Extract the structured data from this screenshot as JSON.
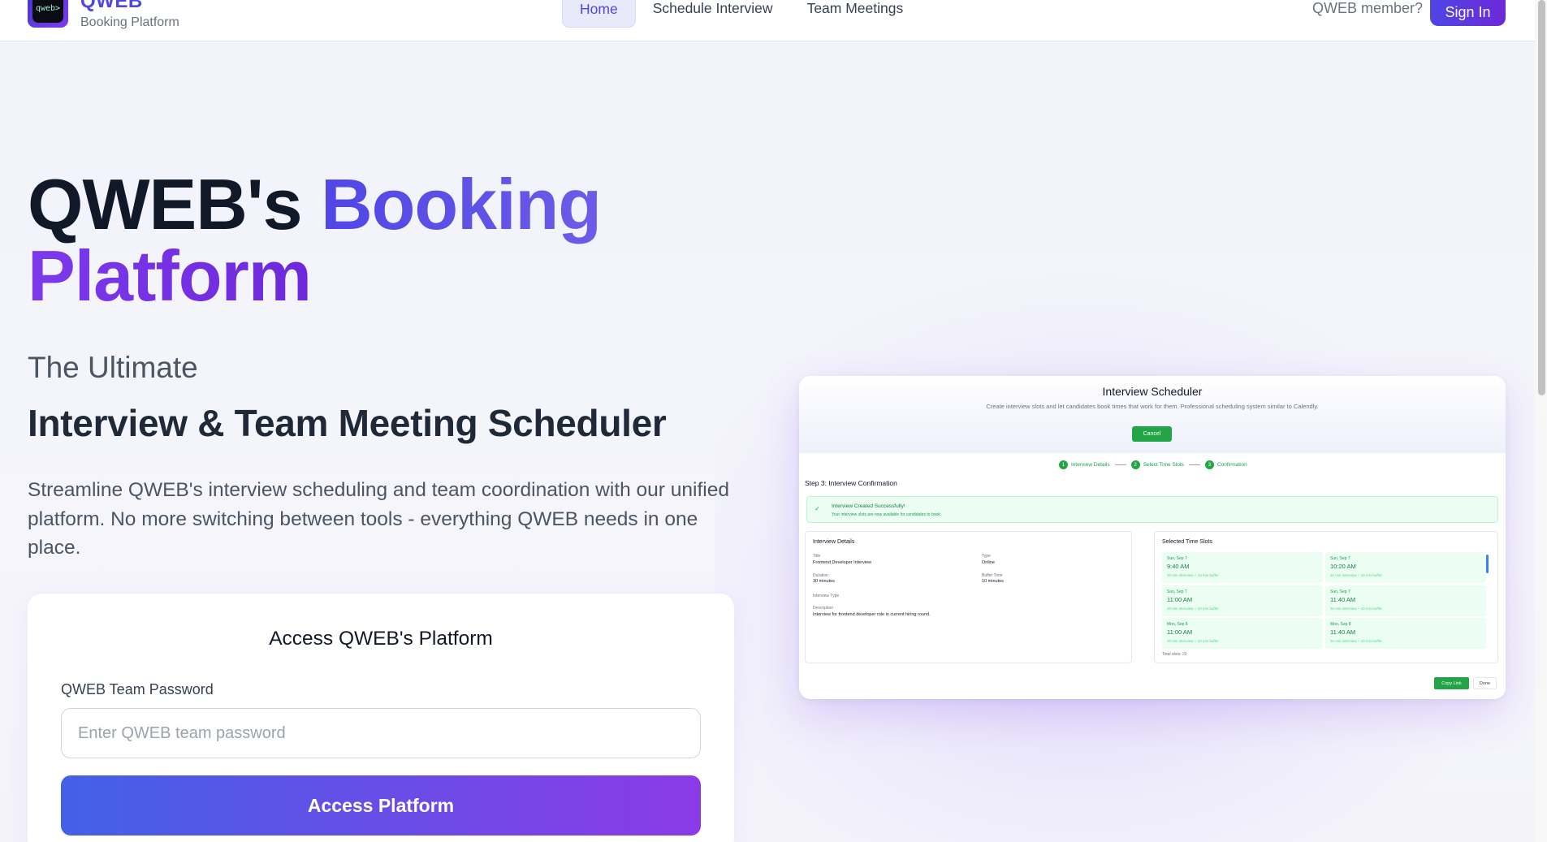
{
  "header": {
    "brand_name": "QWEB",
    "brand_subtitle": "Booking Platform",
    "logo_text": "qweb>",
    "nav": [
      {
        "label": "Home",
        "active": true
      },
      {
        "label": "Schedule Interview",
        "active": false
      },
      {
        "label": "Team Meetings",
        "active": false
      }
    ],
    "member_text": "QWEB member?",
    "signin_label": "Sign In"
  },
  "hero": {
    "title_part1": "QWEB's",
    "title_part2": "Booking",
    "title_part3": "Platform",
    "subtitle_light": "The Ultimate",
    "subtitle_bold": "Interview & Team Meeting Scheduler",
    "description": "Streamline QWEB's interview scheduling and team coordination with our unified platform. No more switching between tools - everything QWEB needs in one place."
  },
  "access": {
    "title": "Access QWEB's Platform",
    "password_label": "QWEB Team Password",
    "password_placeholder": "Enter QWEB team password",
    "button_label": "Access Platform"
  },
  "preview": {
    "title": "Interview Scheduler",
    "subtitle": "Create interview slots and let candidates book times that work for them. Professional scheduling system similar to Calendly.",
    "cancel_label": "Cancel",
    "steps": [
      {
        "num": "1",
        "label": "Interview Details"
      },
      {
        "num": "2",
        "label": "Select Time Slots"
      },
      {
        "num": "3",
        "label": "Confirmation"
      }
    ],
    "step_heading": "Step 3: Interview Confirmation",
    "success_title": "Interview Created Successfully!",
    "success_desc": "Your interview slots are now available for candidates to book.",
    "details": {
      "heading": "Interview Details",
      "title_label": "Title",
      "title_value": "Frontend Developer Interview",
      "type_label": "Type",
      "type_value": "Online",
      "duration_label": "Duration",
      "duration_value": "30 minutes",
      "buffer_label": "Buffer Time",
      "buffer_value": "10 minutes",
      "interview_type_label": "Interview Type",
      "description_label": "Description",
      "description_value": "Interview for frontend developer role in current hiring round."
    },
    "slots": {
      "heading": "Selected Time Slots",
      "items": [
        {
          "date": "Sun, Sep 7",
          "time": "9:40 AM",
          "meta": "30 min interview + 10 min buffer"
        },
        {
          "date": "Sun, Sep 7",
          "time": "10:20 AM",
          "meta": "30 min interview + 10 min buffer"
        },
        {
          "date": "Sun, Sep 7",
          "time": "11:00 AM",
          "meta": "30 min interview + 10 min buffer"
        },
        {
          "date": "Sun, Sep 7",
          "time": "11:40 AM",
          "meta": "30 min interview + 10 min buffer"
        },
        {
          "date": "Mon, Sep 8",
          "time": "11:00 AM",
          "meta": "30 min interview + 10 min buffer"
        },
        {
          "date": "Mon, Sep 8",
          "time": "11:40 AM",
          "meta": "30 min interview + 10 min buffer"
        }
      ],
      "total": "Total slots: 20"
    },
    "copy_label": "Copy Link",
    "done_label": "Done",
    "check_icon": "check-icon"
  }
}
